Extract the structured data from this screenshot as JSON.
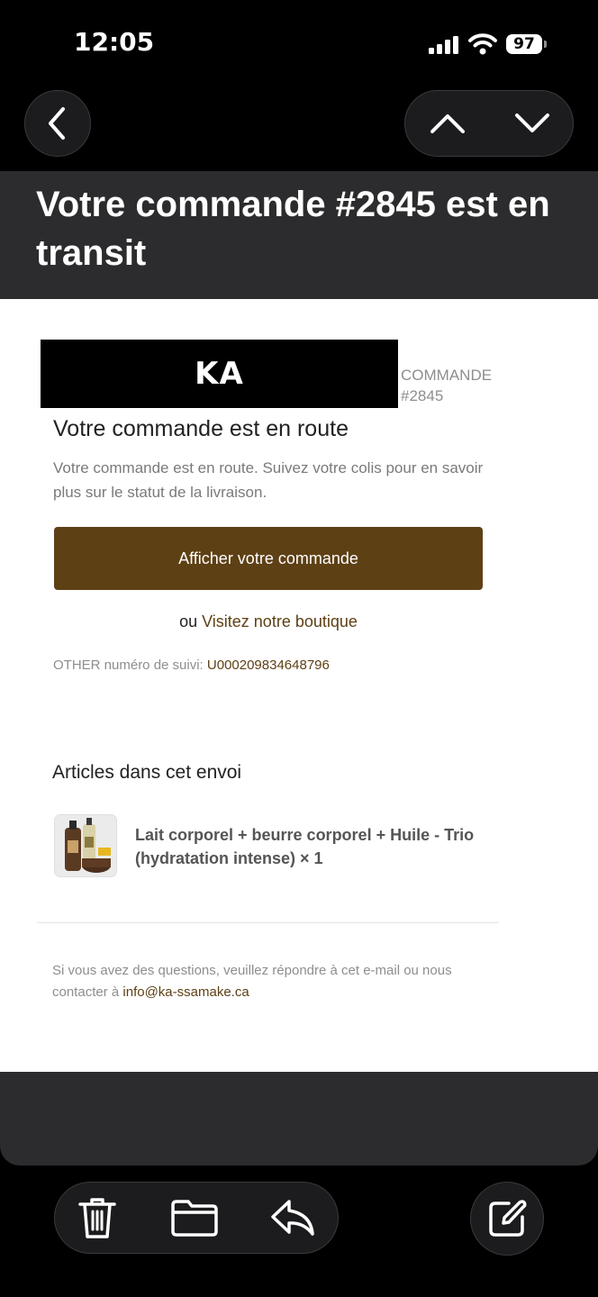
{
  "status_bar": {
    "time": "12:05",
    "battery": "97"
  },
  "email": {
    "subject": "Votre commande #2845 est en transit",
    "logo_text": "KA",
    "order_label_line1": "COMMANDE",
    "order_label_line2": "#2845",
    "heading": "Votre commande est en route",
    "description": "Votre commande est en route. Suivez votre colis pour en savoir plus sur le statut de la livraison.",
    "cta_label": "Afficher votre commande",
    "or_prefix": "ou ",
    "shop_link": "Visitez notre boutique",
    "tracking_label": "OTHER numéro de suivi: ",
    "tracking_number": "U000209834648796",
    "articles_heading": "Articles dans cet envoi",
    "product_name": "Lait corporel + beurre corporel + Huile - Trio (hydratation intense) × 1",
    "footer_text": "Si vous avez des questions, veuillez répondre à cet e-mail ou nous contacter à ",
    "footer_email": "info@ka-ssamake.ca"
  },
  "colors": {
    "accent": "#5e4015",
    "subject_band": "#2c2c2e",
    "background": "#000000"
  },
  "icons": {
    "back": "chevron-left-icon",
    "prev_message": "chevron-up-icon",
    "next_message": "chevron-down-icon",
    "delete": "trash-icon",
    "move": "folder-icon",
    "reply": "reply-icon",
    "compose": "compose-icon"
  }
}
